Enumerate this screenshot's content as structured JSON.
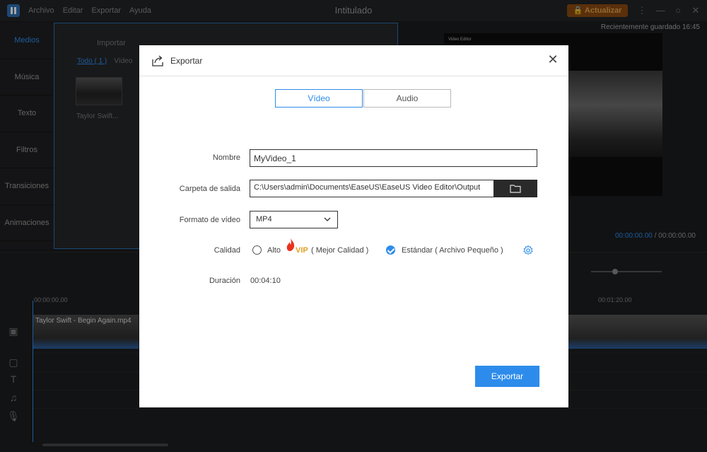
{
  "app": {
    "title": "Intitulado",
    "menu": [
      "Archivo",
      "Editar",
      "Exportar",
      "Ayuda"
    ],
    "upgrade_label": "Actualizar"
  },
  "sidebar": {
    "tabs": [
      "Medios",
      "Música",
      "Texto",
      "Filtros",
      "Transiciones",
      "Animaciones"
    ],
    "active": "Medios"
  },
  "media": {
    "import_label": "Importar",
    "filters": [
      "Todo ( 1 )",
      "Vídeo"
    ],
    "item_label": "Taylor Swift..."
  },
  "preview": {
    "status": "Recientemente guardado 16:45",
    "video_logo": "Video Editor",
    "current_time": "00:00:00.00",
    "total_time": "/ 00:00:00.00"
  },
  "timeline": {
    "ticks": [
      "00:00:00.00",
      "00:01:20.00"
    ],
    "clip_name": "Taylor Swift - Begin Again.mp4"
  },
  "dialog": {
    "title": "Exportar",
    "tabs": [
      "Vídeo",
      "Audio"
    ],
    "active_tab": "Vídeo",
    "name_label": "Nombre",
    "name_value": "MyVideo_1",
    "folder_label": "Carpeta de salida",
    "folder_value": "C:\\Users\\admin\\Documents\\EaseUS\\EaseUS Video Editor\\Output",
    "format_label": "Formato de vídeo",
    "format_value": "MP4",
    "quality_label": "Calidad",
    "quality_high": "Alto",
    "vip_label": "VIP",
    "quality_high_desc": "( Mejor Calidad )",
    "quality_std": "Estándar ( Archivo Pequeño )",
    "quality_selected": "Estándar",
    "duration_label": "Duración",
    "duration_value": "00:04:10",
    "export_button": "Exportar"
  },
  "colors": {
    "accent": "#2d8ceb",
    "vip": "#e0a020",
    "flame": "#e8331c"
  }
}
